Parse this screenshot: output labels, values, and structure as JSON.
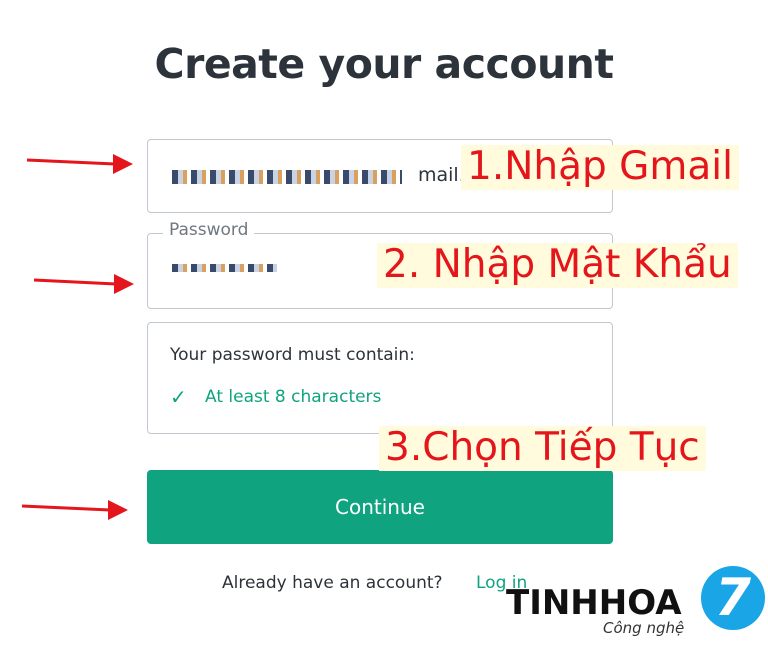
{
  "page": {
    "title": "Create your account"
  },
  "email_field": {
    "visible_tail": "mail.com"
  },
  "password_field": {
    "label": "Password",
    "masked_value": "• • • • • •"
  },
  "requirements": {
    "title": "Your password must contain:",
    "check_symbol": "✓",
    "items": [
      "At least 8 characters"
    ]
  },
  "buttons": {
    "continue_label": "Continue"
  },
  "footer": {
    "already_text": "Already have an account?",
    "login_link": "Log in"
  },
  "annotations": {
    "step1": "1.Nhập Gmail",
    "step2": "2. Nhập Mật Khẩu",
    "step3": "3.Chọn Tiếp Tục"
  },
  "logo": {
    "text": "TINHHOA",
    "subtitle": "Công nghệ",
    "badge": "7"
  },
  "colors": {
    "accent": "#10a37f",
    "annotation_text": "#e4151b",
    "annotation_bg": "#fffbdc",
    "logo_badge": "#1aa6e6"
  }
}
